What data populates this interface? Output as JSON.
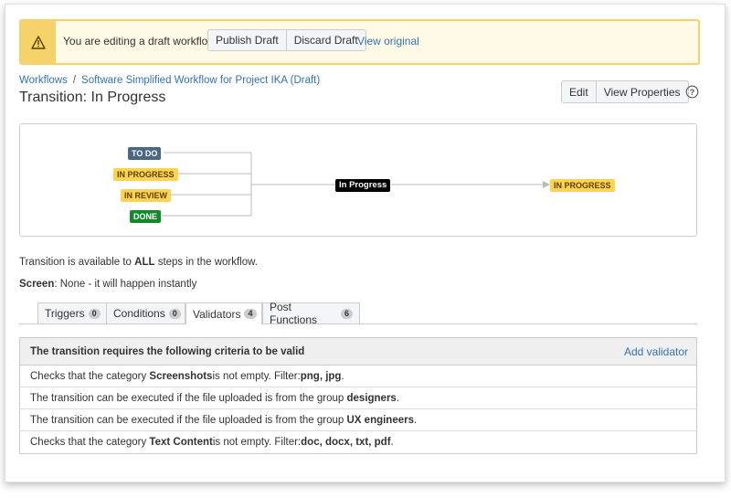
{
  "banner": {
    "message": "You are editing a draft workflow.",
    "publish_label": "Publish Draft",
    "discard_label": "Discard Draft",
    "view_original_label": "View original"
  },
  "breadcrumb": {
    "root": "Workflows",
    "separator": "/",
    "current": "Software Simplified Workflow for Project IKA (Draft)"
  },
  "page_title": "Transition: In Progress",
  "header_actions": {
    "edit_label": "Edit",
    "view_properties_label": "View Properties"
  },
  "diagram": {
    "source_statuses": [
      "TO DO",
      "IN PROGRESS",
      "IN REVIEW",
      "DONE"
    ],
    "transition_label": "In Progress",
    "target_status": "IN PROGRESS"
  },
  "info": {
    "availability_prefix": "Transition is available to ",
    "availability_bold": "ALL",
    "availability_suffix": " steps in the workflow.",
    "screen_label": "Screen",
    "screen_value": ": None - it will happen instantly"
  },
  "tabs": [
    {
      "label": "Triggers",
      "count": "0"
    },
    {
      "label": "Conditions",
      "count": "0"
    },
    {
      "label": "Validators",
      "count": "4"
    },
    {
      "label": "Post Functions",
      "count": "6"
    }
  ],
  "validators": {
    "header": "The transition requires the following criteria to be valid",
    "add_label": "Add validator",
    "rows": [
      {
        "pre": "Checks that the category ",
        "bold1": "Screenshots",
        "mid": " is not empty. Filter: ",
        "bold2": "png, jpg",
        "post": "."
      },
      {
        "pre": "The transition can be executed if the file uploaded is from the group ",
        "bold1": "designers",
        "mid": " .",
        "bold2": "",
        "post": ""
      },
      {
        "pre": "The transition can be executed if the file uploaded is from the group ",
        "bold1": "UX engineers",
        "mid": " .",
        "bold2": "",
        "post": ""
      },
      {
        "pre": "Checks that the category ",
        "bold1": "Text Content",
        "mid": " is not empty. Filter: ",
        "bold2": "doc, docx, txt, pdf",
        "post": "."
      }
    ]
  },
  "colors": {
    "link": "#3572b0",
    "banner_bg": "#fffae6",
    "banner_border": "#f6d26b",
    "status_todo": "#4a6785",
    "status_inprogress": "#ffd351",
    "status_done": "#14892c"
  },
  "icons": {
    "banner": "warning-icon",
    "help": "help-icon"
  }
}
